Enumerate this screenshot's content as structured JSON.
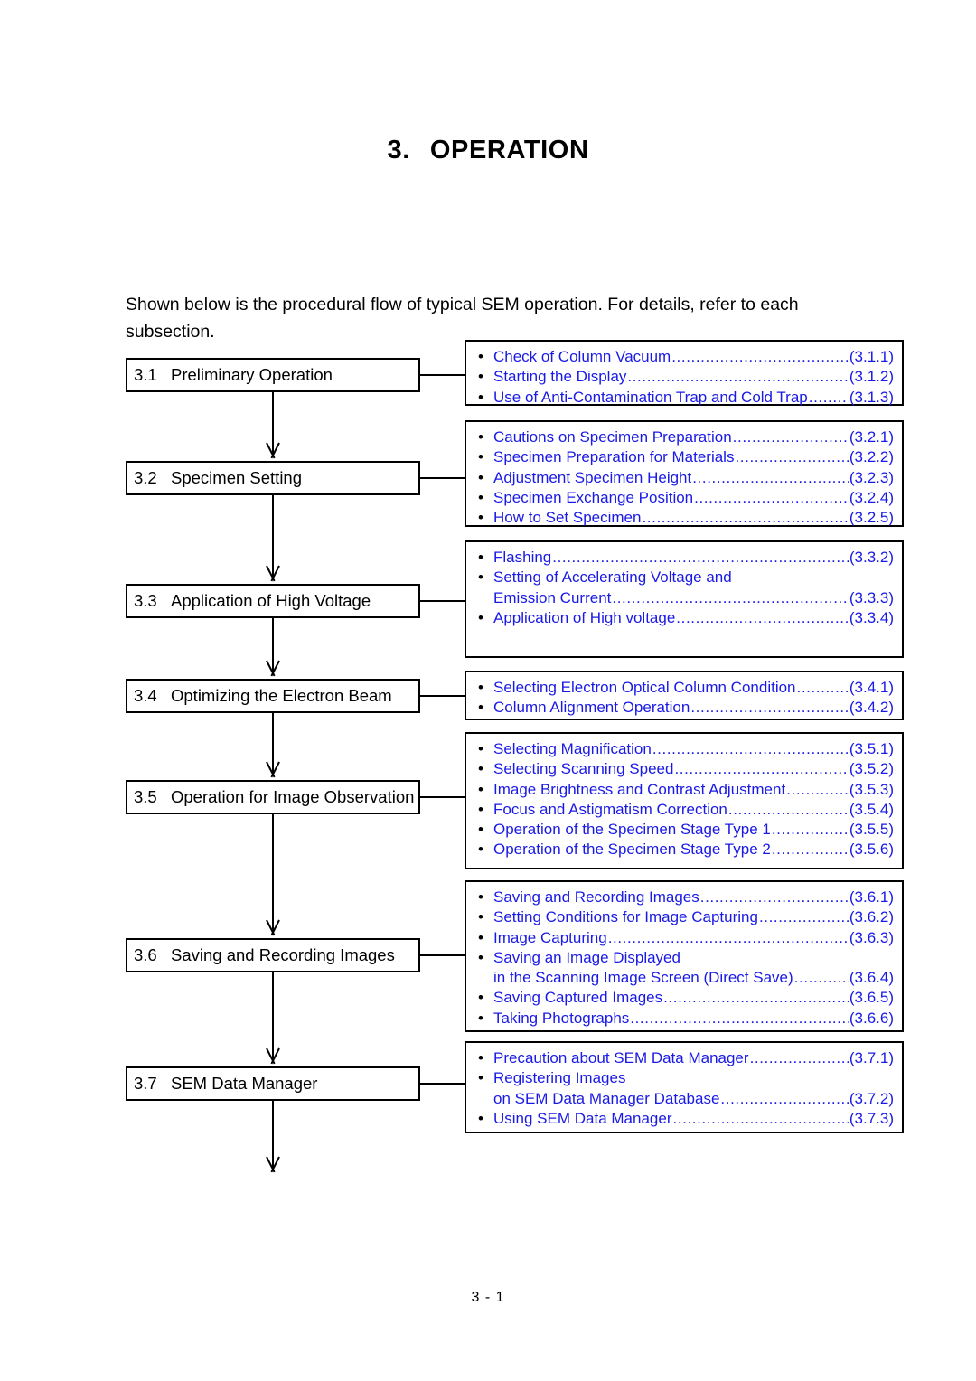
{
  "title": {
    "number": "3.",
    "text": "OPERATION"
  },
  "intro": "Shown below is the procedural flow of typical SEM operation. For details, refer to each subsection.",
  "footer": "3 - 1",
  "colors": {
    "reference_text": "#1a1ae6",
    "body_text": "#000000",
    "line": "#000000"
  },
  "flow": {
    "steps": [
      {
        "number": "3.1",
        "label": "Preliminary Operation"
      },
      {
        "number": "3.2",
        "label": "Specimen Setting"
      },
      {
        "number": "3.3",
        "label": "Application of High Voltage"
      },
      {
        "number": "3.4",
        "label": "Optimizing the Electron Beam"
      },
      {
        "number": "3.5",
        "label": "Operation for Image Observation"
      },
      {
        "number": "3.6",
        "label": "Saving and Recording Images"
      },
      {
        "number": "3.7",
        "label": "SEM Data Manager"
      }
    ]
  },
  "panels": [
    {
      "for_step": "3.1",
      "items": [
        {
          "text": "Check of Column Vacuum",
          "ref": "(3.1.1)",
          "leader": true
        },
        {
          "text": "Starting the Display",
          "ref": "(3.1.2)",
          "leader": true
        },
        {
          "text": "Use of Anti-Contamination Trap and Cold Trap",
          "ref": "(3.1.3)",
          "leader": true
        }
      ]
    },
    {
      "for_step": "3.2",
      "items": [
        {
          "text": "Cautions on Specimen Preparation",
          "ref": "(3.2.1)",
          "leader": true
        },
        {
          "text": "Specimen Preparation for Materials",
          "ref": "(3.2.2)",
          "leader": true
        },
        {
          "text": "Adjustment Specimen Height",
          "ref": "(3.2.3)",
          "leader": true
        },
        {
          "text": "Specimen Exchange Position",
          "ref": "(3.2.4)",
          "leader": true
        },
        {
          "text": "How to Set Specimen",
          "ref": "(3.2.5)",
          "leader": true
        }
      ]
    },
    {
      "for_step": "3.3",
      "items": [
        {
          "text": "Flashing",
          "ref": "(3.3.2)",
          "leader": true
        },
        {
          "text": "Setting of Accelerating Voltage and",
          "ref": "",
          "leader": false,
          "continuation": {
            "text": "Emission Current",
            "ref": "(3.3.3)",
            "leader": true
          }
        },
        {
          "text": "Application of High voltage",
          "ref": "(3.3.4)",
          "leader": true
        }
      ]
    },
    {
      "for_step": "3.4",
      "items": [
        {
          "text": "Selecting Electron Optical Column Condition",
          "ref": "(3.4.1)",
          "leader": true
        },
        {
          "text": "Column Alignment Operation",
          "ref": "(3.4.2)",
          "leader": true
        }
      ]
    },
    {
      "for_step": "3.5",
      "items": [
        {
          "text": "Selecting Magnification",
          "ref": "(3.5.1)",
          "leader": true
        },
        {
          "text": "Selecting Scanning Speed",
          "ref": "(3.5.2)",
          "leader": true
        },
        {
          "text": "Image Brightness and Contrast Adjustment",
          "ref": "(3.5.3)",
          "leader": true
        },
        {
          "text": "Focus and Astigmatism Correction",
          "ref": "(3.5.4)",
          "leader": true
        },
        {
          "text": "Operation of the Specimen Stage Type 1",
          "ref": "(3.5.5)",
          "leader": true
        },
        {
          "text": "Operation of the Specimen Stage Type 2",
          "ref": "(3.5.6)",
          "leader": true
        }
      ]
    },
    {
      "for_step": "3.6",
      "items": [
        {
          "text": "Saving and Recording Images",
          "ref": "(3.6.1)",
          "leader": true
        },
        {
          "text": "Setting Conditions for Image Capturing",
          "ref": "(3.6.2)",
          "leader": true
        },
        {
          "text": "Image Capturing",
          "ref": "(3.6.3)",
          "leader": true
        },
        {
          "text": "Saving an Image Displayed",
          "ref": "",
          "leader": false,
          "continuation": {
            "text": "in the Scanning Image Screen (Direct Save)",
            "ref": "(3.6.4)",
            "leader": true
          }
        },
        {
          "text": "Saving Captured Images",
          "ref": "(3.6.5)",
          "leader": true
        },
        {
          "text": "Taking Photographs",
          "ref": "(3.6.6)",
          "leader": true
        }
      ]
    },
    {
      "for_step": "3.7",
      "items": [
        {
          "text": "Precaution about SEM Data Manager",
          "ref": "(3.7.1)",
          "leader": true
        },
        {
          "text": "Registering Images",
          "ref": "",
          "leader": false,
          "continuation": {
            "text": "on SEM Data Manager Database",
            "ref": "(3.7.2)",
            "leader": true
          }
        },
        {
          "text": "Using SEM Data Manager",
          "ref": "(3.7.3)",
          "leader": true
        }
      ]
    }
  ]
}
